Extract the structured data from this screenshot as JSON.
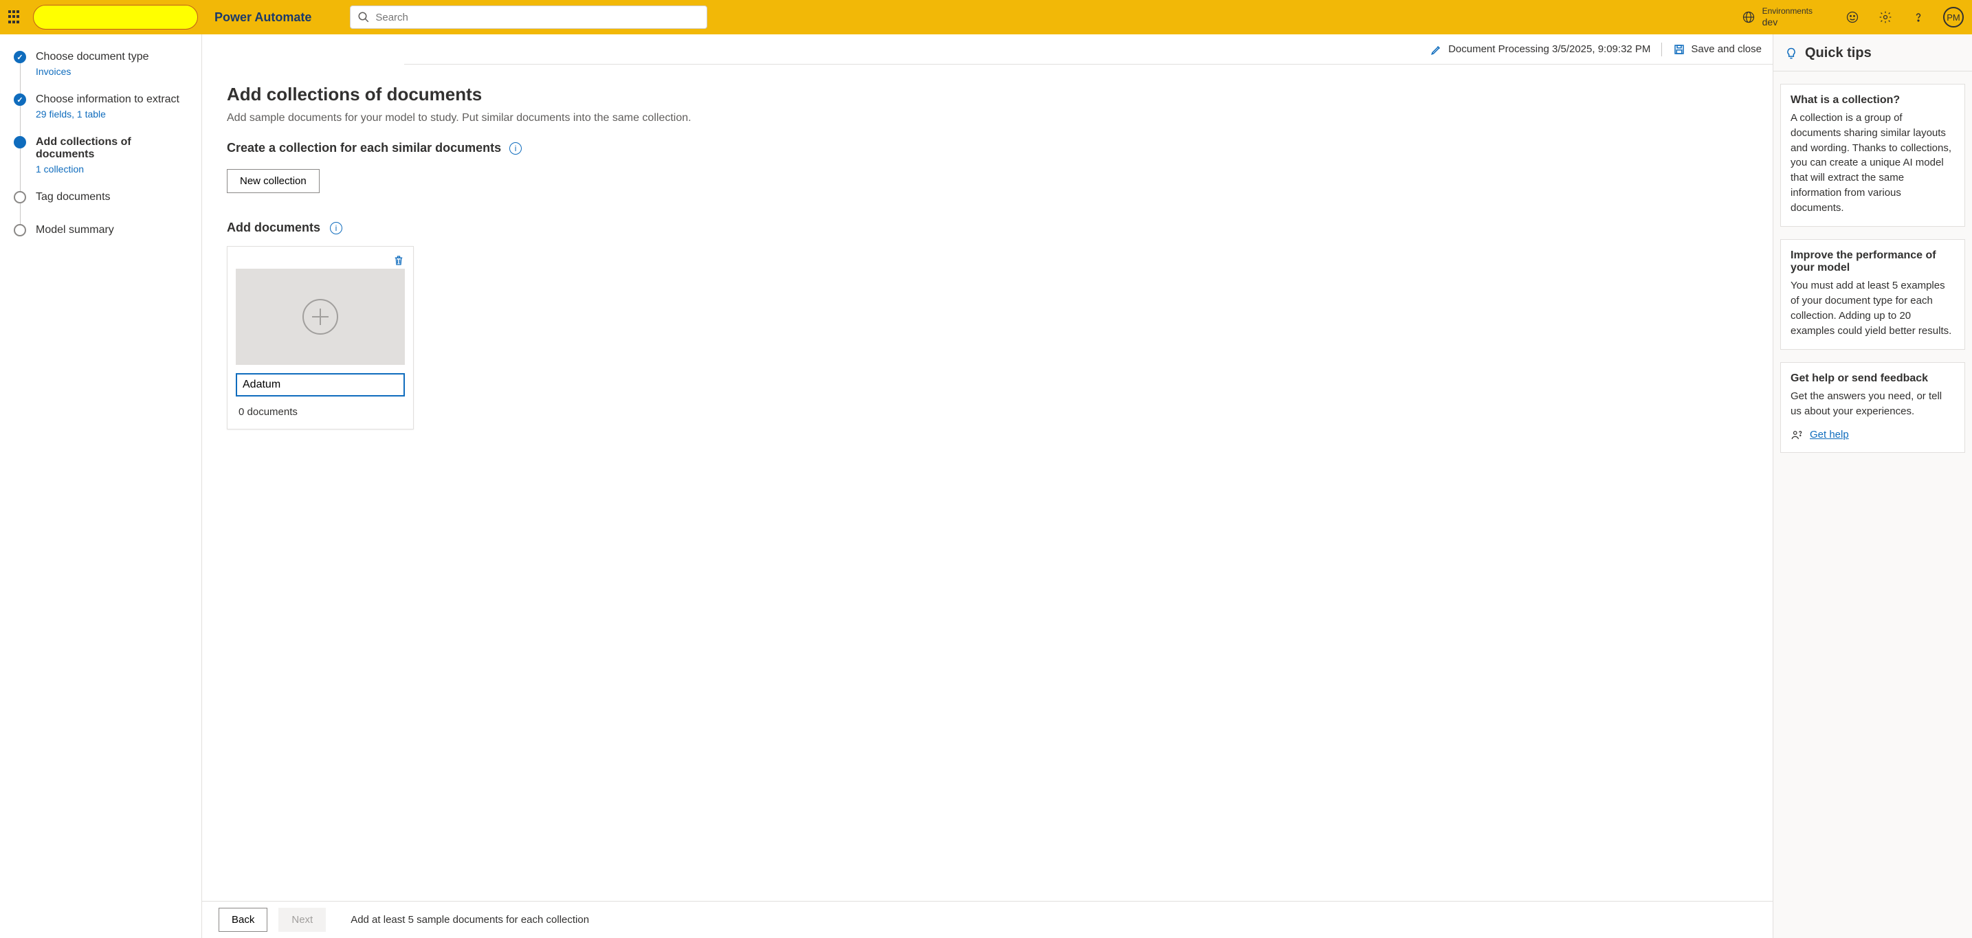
{
  "header": {
    "brand": "Power Automate",
    "search_placeholder": "Search",
    "env_label": "Environments",
    "env_value": "dev",
    "avatar_initials": "PM"
  },
  "subheader": {
    "doc_name": "Document Processing 3/5/2025, 9:09:32 PM",
    "save_label": "Save and close"
  },
  "steps": [
    {
      "title": "Choose document type",
      "sub": "Invoices",
      "state": "done"
    },
    {
      "title": "Choose information to extract",
      "sub": "29 fields, 1 table",
      "state": "done"
    },
    {
      "title": "Add collections of documents",
      "sub": "1 collection",
      "state": "current"
    },
    {
      "title": "Tag documents",
      "sub": "",
      "state": "future"
    },
    {
      "title": "Model summary",
      "sub": "",
      "state": "future"
    }
  ],
  "main": {
    "h1": "Add collections of documents",
    "desc": "Add sample documents for your model to study. Put similar documents into the same collection.",
    "create_label": "Create a collection for each similar documents",
    "new_collection_btn": "New collection",
    "add_docs_label": "Add documents",
    "collection_name": "Adatum",
    "doc_count": "0 documents"
  },
  "footer": {
    "back": "Back",
    "next": "Next",
    "hint": "Add at least 5 sample documents for each collection"
  },
  "tips": {
    "header": "Quick tips",
    "cards": [
      {
        "title": "What is a collection?",
        "body": "A collection is a group of documents sharing similar layouts and wording. Thanks to collections, you can create a unique AI model that will extract the same information from various documents."
      },
      {
        "title": "Improve the performance of your model",
        "body": "You must add at least 5 examples of your document type for each collection. Adding up to 20 examples could yield better results."
      },
      {
        "title": "Get help or send feedback",
        "body": "Get the answers you need, or tell us about your experiences."
      }
    ],
    "get_help": "Get help"
  }
}
